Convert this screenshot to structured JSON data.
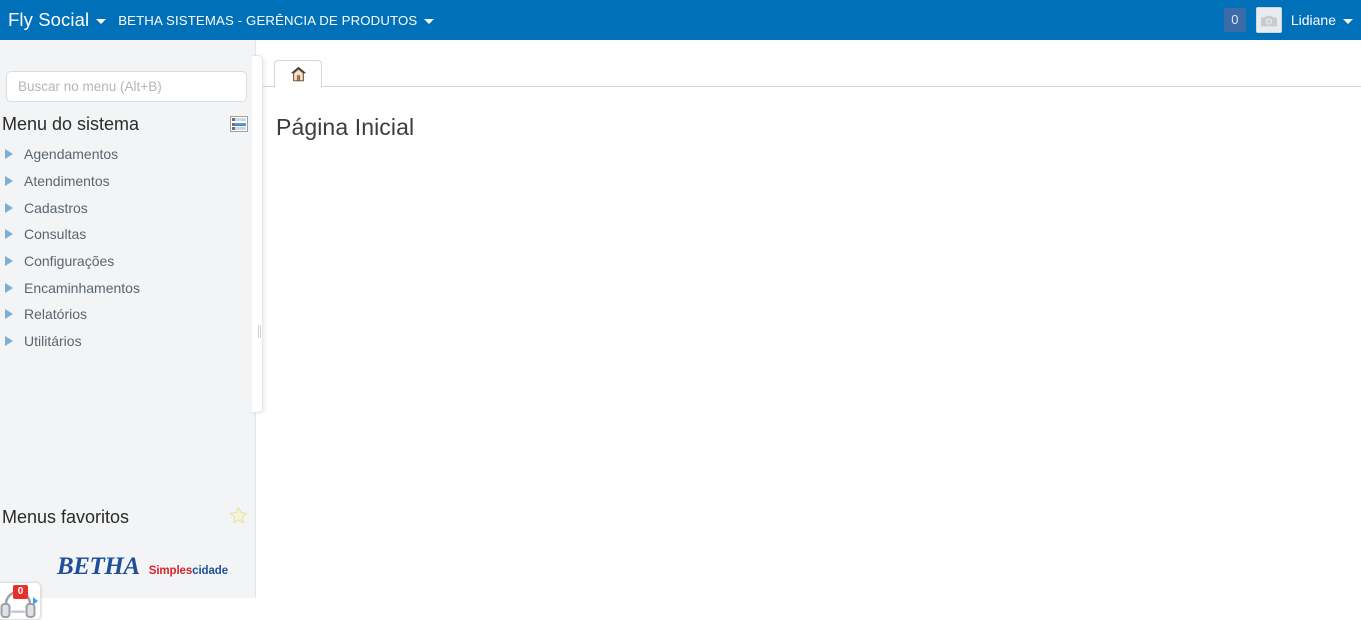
{
  "header": {
    "brand": "Fly Social",
    "brand_caret_icon": "caret-down-icon",
    "organization": "BETHA SISTEMAS - GERÊNCIA DE PRODUTOS",
    "organization_caret_icon": "caret-down-icon",
    "notification_count": "0",
    "avatar_icon": "camera-icon",
    "user_name": "Lidiane",
    "user_caret_icon": "caret-down-icon",
    "background_color": "#0070b8",
    "badge_color": "#3b6ca8"
  },
  "sidebar": {
    "search": {
      "placeholder": "Buscar no menu (Alt+B)",
      "value": ""
    },
    "system_menu": {
      "title": "Menu do sistema",
      "icon": "list-view-icon"
    },
    "items": [
      {
        "label": "Agendamentos",
        "expand_icon": "triangle-right-icon"
      },
      {
        "label": "Atendimentos",
        "expand_icon": "triangle-right-icon"
      },
      {
        "label": "Cadastros",
        "expand_icon": "triangle-right-icon"
      },
      {
        "label": "Consultas",
        "expand_icon": "triangle-right-icon"
      },
      {
        "label": "Configurações",
        "expand_icon": "triangle-right-icon"
      },
      {
        "label": "Encaminhamentos",
        "expand_icon": "triangle-right-icon"
      },
      {
        "label": "Relatórios",
        "expand_icon": "triangle-right-icon"
      },
      {
        "label": "Utilitários",
        "expand_icon": "triangle-right-icon"
      }
    ],
    "favorites": {
      "title": "Menus favoritos",
      "icon": "star-icon",
      "star_color": "#ecebc0"
    },
    "logo": {
      "brand": "BETHA",
      "tagline_primary": "Simples",
      "tagline_secondary": "cidade",
      "brand_color": "#1f4e9c",
      "tagline_primary_color": "#d8232a"
    },
    "support_widget": {
      "icon": "headset-icon",
      "badge_count": "0",
      "badge_color": "#e8302a",
      "expand_icon": "triangle-right-icon"
    },
    "background_color": "#f2f4f5"
  },
  "main": {
    "tabs": [
      {
        "label": "",
        "icon": "home-icon",
        "active": true
      }
    ],
    "page_title": "Página Inicial"
  }
}
